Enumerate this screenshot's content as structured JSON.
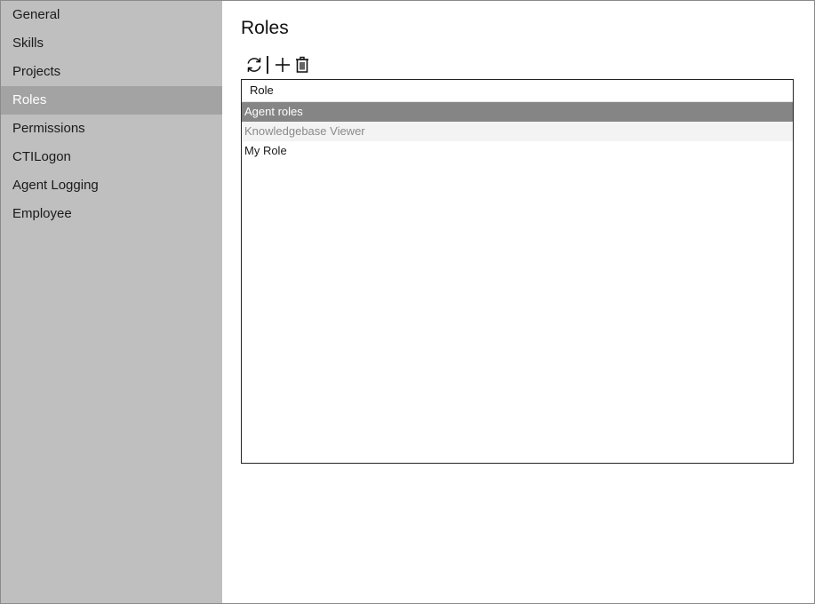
{
  "sidebar": {
    "items": [
      {
        "label": "General"
      },
      {
        "label": "Skills"
      },
      {
        "label": "Projects"
      },
      {
        "label": "Roles"
      },
      {
        "label": "Permissions"
      },
      {
        "label": "CTILogon"
      },
      {
        "label": "Agent Logging"
      },
      {
        "label": "Employee"
      }
    ],
    "active_item": "Roles"
  },
  "main": {
    "title": "Roles",
    "toolbar": {
      "refresh_icon": "refresh-icon",
      "add_icon": "plus-icon",
      "delete_icon": "trash-icon"
    },
    "table": {
      "columns": [
        "Role"
      ],
      "rows": [
        {
          "role": "Agent roles",
          "state": "selected"
        },
        {
          "role": "Knowledgebase Viewer",
          "state": "disabled"
        },
        {
          "role": "My Role",
          "state": "normal"
        }
      ]
    }
  },
  "colors": {
    "sidebar_bg": "#bfbfbf",
    "sidebar_active_bg": "#a3a3a3",
    "row_selected_bg": "#858585",
    "row_disabled_bg": "#f3f3f3"
  }
}
